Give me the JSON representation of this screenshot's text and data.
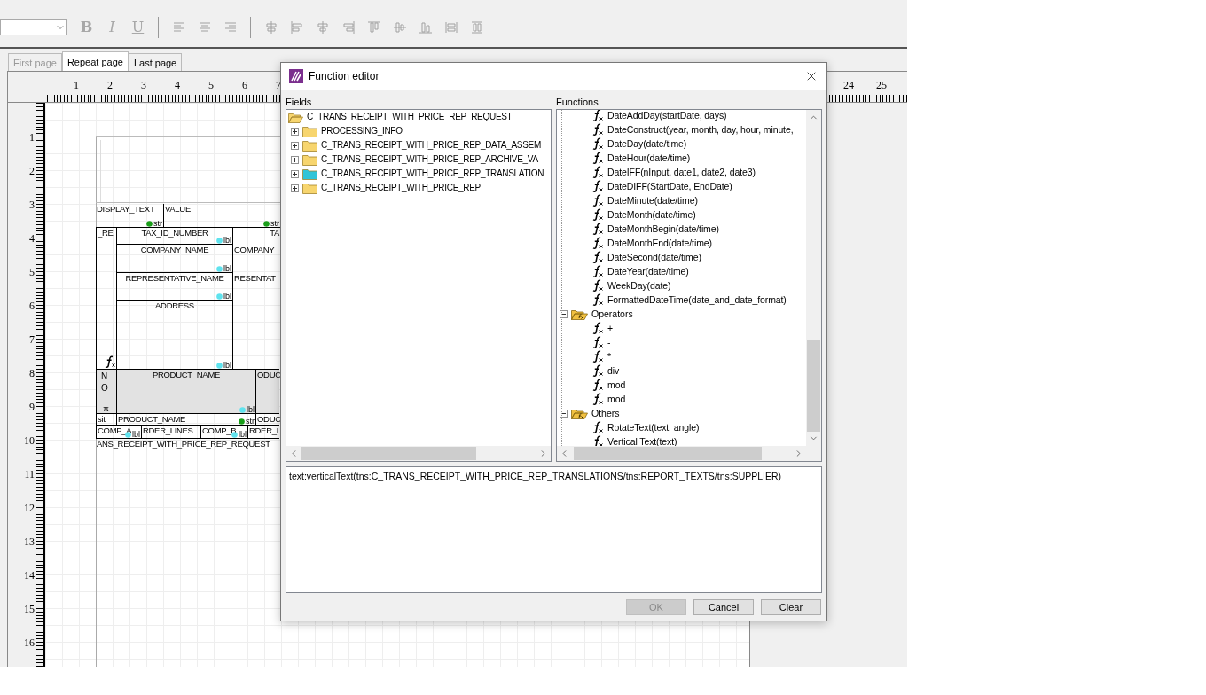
{
  "toolbar": {
    "format_buttons": [
      {
        "label": "B",
        "disabled": true
      },
      {
        "label": "I",
        "disabled": true
      },
      {
        "label": "U",
        "disabled": true
      }
    ]
  },
  "tabs": [
    {
      "label": "First page",
      "selected": false,
      "disabled": true
    },
    {
      "label": "Repeat page",
      "selected": true,
      "disabled": false
    },
    {
      "label": "Last page",
      "selected": false,
      "disabled": false
    }
  ],
  "horizontal_ruler": {
    "left_labels": [
      "1",
      "2",
      "3",
      "4",
      "5",
      "6",
      "7"
    ],
    "right_labels": [
      "24",
      "25"
    ]
  },
  "vertical_ruler": [
    "1",
    "2",
    "3",
    "4",
    "5",
    "6",
    "7",
    "8",
    "9",
    "10",
    "11",
    "12",
    "13",
    "14",
    "15",
    "16"
  ],
  "designer": [
    {
      "text": "DISPLAY_TEXT",
      "marker": {
        "color": "#1a9e1a",
        "text": "str"
      }
    },
    {
      "text": "VALUE",
      "marker": {
        "color": "#1a9e1a",
        "text": "str"
      }
    },
    {
      "text": "_RE"
    },
    {
      "text": "TAX_ID_NUMBER",
      "marker": {
        "color": "#5fe3ee",
        "text": "lbl"
      }
    },
    {
      "text": "TA"
    },
    {
      "text": "COMPANY_NAME",
      "marker": {
        "color": "#5fe3ee",
        "text": "lbl"
      }
    },
    {
      "text": "COMPANY_"
    },
    {
      "text": "REPRESENTATIVE_NAME",
      "marker": {
        "color": "#5fe3ee",
        "text": "lbl"
      }
    },
    {
      "text": "RESENTAT"
    },
    {
      "text": "ADDRESS",
      "marker": {
        "color": "#5fe3ee",
        "text": "lbl"
      }
    },
    {
      "text": "NO"
    },
    {
      "text": "π"
    },
    {
      "text": "PRODUCT_NAME",
      "marker": {
        "color": "#5fe3ee",
        "text": "lbl"
      }
    },
    {
      "text": "ODUC"
    },
    {
      "text": "sit"
    },
    {
      "text": "PRODUCT_NAME",
      "marker": {
        "color": "#1a9e1a",
        "text": "str"
      }
    },
    {
      "text": "ODUC"
    },
    {
      "text": "COMP_A",
      "marker": {
        "color": "#5fe3ee",
        "text": "lbl"
      }
    },
    {
      "text": "RDER_LINES"
    },
    {
      "text": "COMP_B",
      "marker": {
        "color": "#5fe3ee",
        "text": "lbl"
      }
    },
    {
      "text": "RDER_L"
    },
    {
      "text": "ANS_RECEIPT_WITH_PRICE_REP_REQUEST"
    }
  ],
  "dialog": {
    "title": "Function editor",
    "fields": {
      "label": "Fields",
      "tree": [
        {
          "label": "C_TRANS_RECEIPT_WITH_PRICE_REP_REQUEST",
          "expanded": true,
          "color": "#f7d56e",
          "children": [
            {
              "label": "PROCESSING_INFO",
              "expanded": false,
              "color": "#f7d56e"
            },
            {
              "label": "C_TRANS_RECEIPT_WITH_PRICE_REP_DATA_ASSEM",
              "expanded": false,
              "color": "#f7d56e"
            },
            {
              "label": "C_TRANS_RECEIPT_WITH_PRICE_REP_ARCHIVE_VA",
              "expanded": false,
              "color": "#f7d56e"
            },
            {
              "label": "C_TRANS_RECEIPT_WITH_PRICE_REP_TRANSLATION",
              "expanded": false,
              "color": "#30c4d8"
            },
            {
              "label": "C_TRANS_RECEIPT_WITH_PRICE_REP",
              "expanded": false,
              "color": "#f7d56e"
            }
          ]
        }
      ]
    },
    "functions": {
      "label": "Functions",
      "tree": [
        {
          "kind": "function",
          "label": "DateAddDay(startDate, days)"
        },
        {
          "kind": "function",
          "label": "DateConstruct(year, month, day, hour, minute,"
        },
        {
          "kind": "function",
          "label": "DateDay(date/time)"
        },
        {
          "kind": "function",
          "label": "DateHour(date/time)"
        },
        {
          "kind": "function",
          "label": "DateIFF(nInput, date1, date2, date3)"
        },
        {
          "kind": "function",
          "label": "DateDIFF(StartDate, EndDate)"
        },
        {
          "kind": "function",
          "label": "DateMinute(date/time)"
        },
        {
          "kind": "function",
          "label": "DateMonth(date/time)"
        },
        {
          "kind": "function",
          "label": "DateMonthBegin(date/time)"
        },
        {
          "kind": "function",
          "label": "DateMonthEnd(date/time)"
        },
        {
          "kind": "function",
          "label": "DateSecond(date/time)"
        },
        {
          "kind": "function",
          "label": "DateYear(date/time)"
        },
        {
          "kind": "function",
          "label": "WeekDay(date)"
        },
        {
          "kind": "function",
          "label": "FormattedDateTime(date_and_date_format)"
        },
        {
          "kind": "group",
          "label": "Operators",
          "expanded": true,
          "children": [
            {
              "kind": "function",
              "label": "+"
            },
            {
              "kind": "function",
              "label": "-"
            },
            {
              "kind": "function",
              "label": "*"
            },
            {
              "kind": "function",
              "label": "div"
            },
            {
              "kind": "function",
              "label": "mod"
            },
            {
              "kind": "function",
              "label": "mod"
            }
          ]
        },
        {
          "kind": "group",
          "label": "Others",
          "expanded": true,
          "children": [
            {
              "kind": "function",
              "label": "RotateText(text, angle)"
            },
            {
              "kind": "function",
              "label": "Vertical Text(text)"
            }
          ]
        }
      ]
    },
    "expression": {
      "value": "text:verticalText(tns:C_TRANS_RECEIPT_WITH_PRICE_REP_TRANSLATIONS/tns:REPORT_TEXTS/tns:SUPPLIER)"
    },
    "buttons": [
      {
        "label": "OK",
        "disabled": true
      },
      {
        "label": "Cancel",
        "disabled": false
      },
      {
        "label": "Clear",
        "disabled": false
      }
    ]
  }
}
